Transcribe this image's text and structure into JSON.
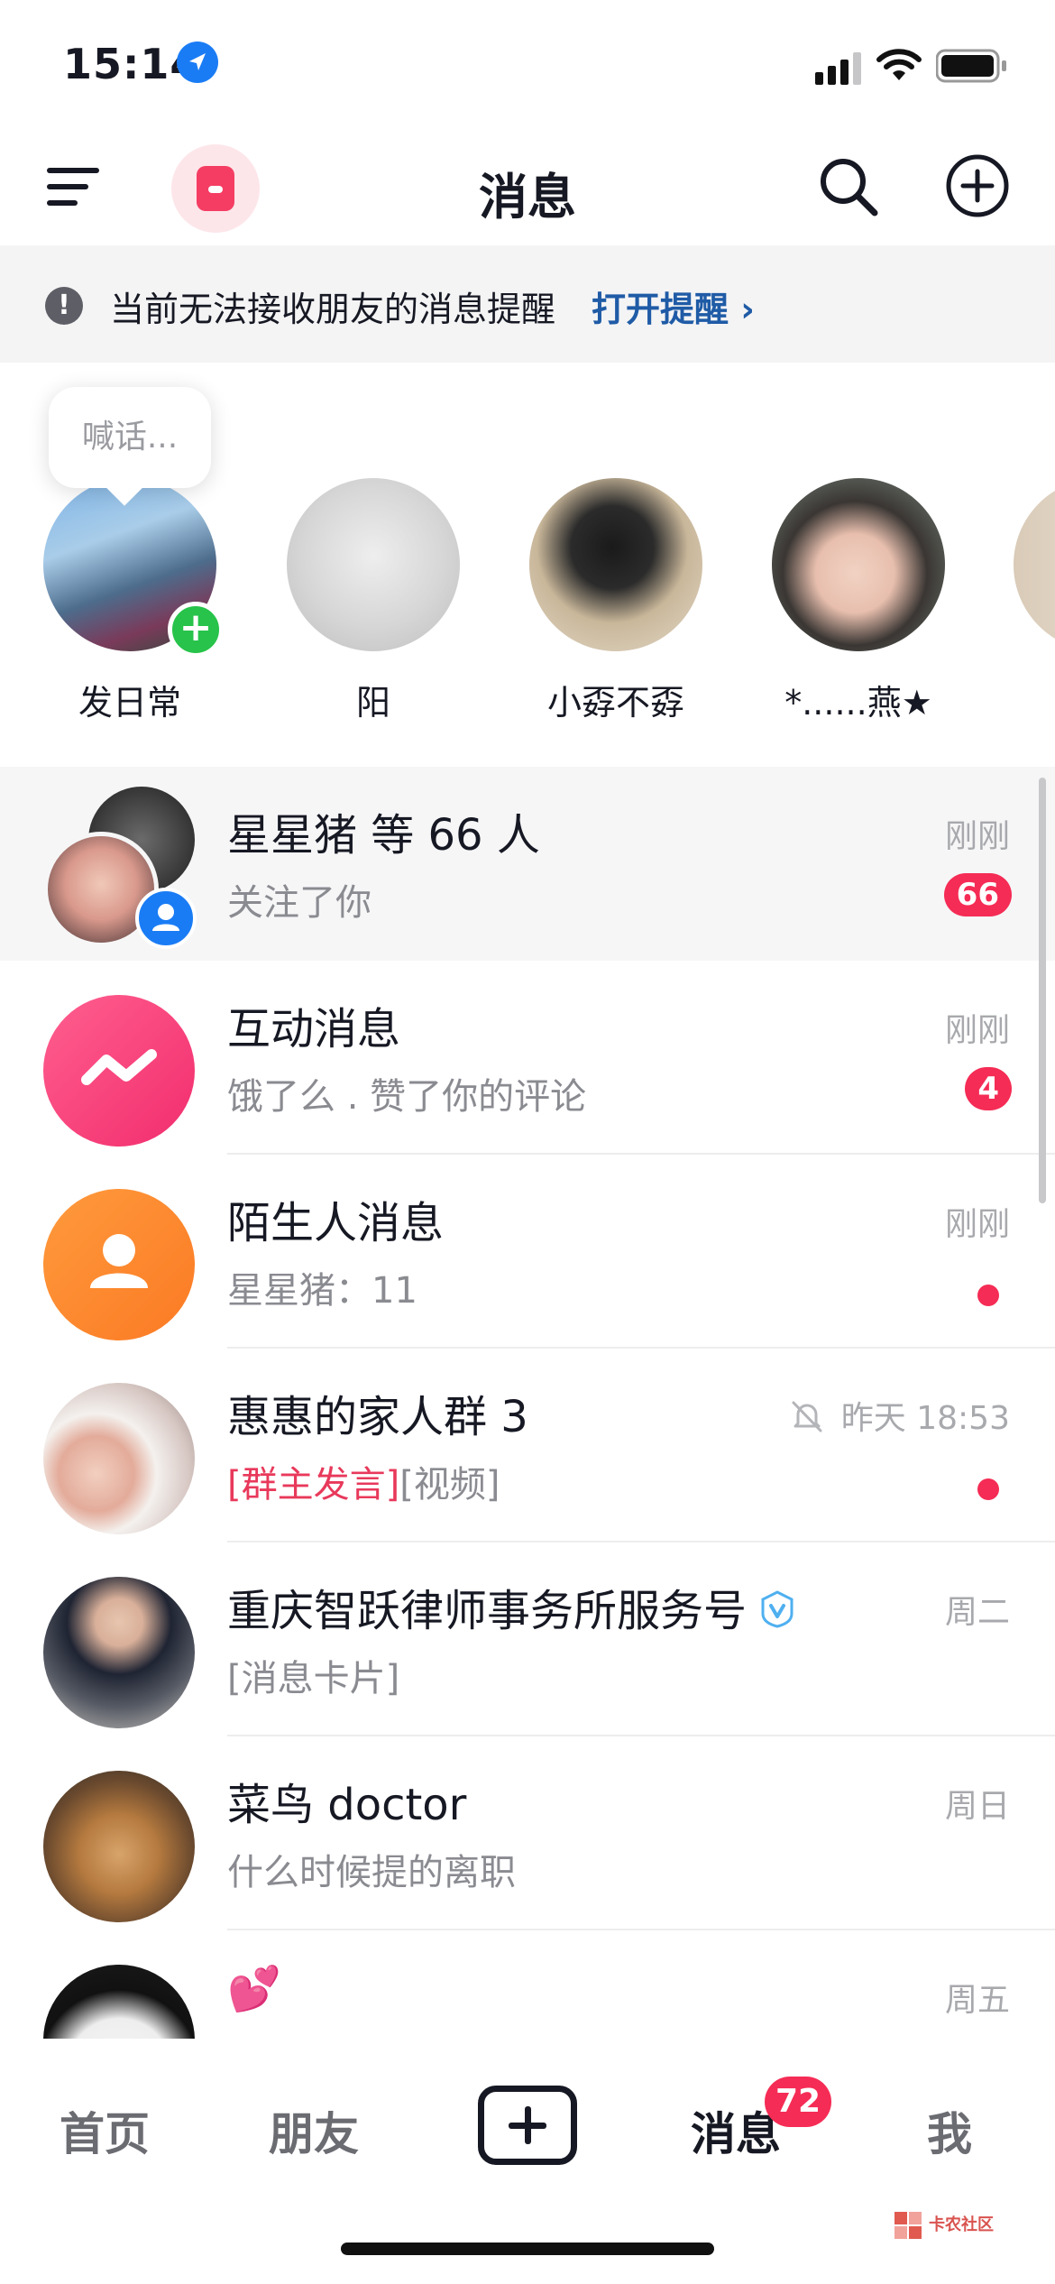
{
  "status_bar": {
    "time": "15:14"
  },
  "header": {
    "title": "消息"
  },
  "notice": {
    "text": "当前无法接收朋友的消息提醒",
    "link": "打开提醒 ›"
  },
  "stories": {
    "bubble": "喊话...",
    "items": [
      {
        "name": "发日常"
      },
      {
        "name": "阳"
      },
      {
        "name": "小孬不孬"
      },
      {
        "name": "*......燕★"
      }
    ]
  },
  "conversations": [
    {
      "title": "星星猪 等 66 人",
      "preview": "关注了你",
      "time": "刚刚",
      "badge": "66"
    },
    {
      "title": "互动消息",
      "preview": "饿了么 . 赞了你的评论",
      "time": "刚刚",
      "badge": "4"
    },
    {
      "title": "陌生人消息",
      "preview": "星星猪：11",
      "time": "刚刚"
    },
    {
      "title": "惠惠的家人群 3",
      "preview_highlight": "[群主发言]",
      "preview": "[视频]",
      "time": "昨天 18:53"
    },
    {
      "title": "重庆智跃律师事务所服务号",
      "preview": "[消息卡片]",
      "time": "周二"
    },
    {
      "title": "菜鸟 doctor",
      "preview": "什么时候提的离职",
      "time": "周日"
    },
    {
      "title": "💕",
      "preview": "",
      "time": "周五"
    }
  ],
  "tab_bar": {
    "home": "首页",
    "friends": "朋友",
    "messages": "消息",
    "messages_badge": "72",
    "me": "我"
  },
  "watermark": {
    "text": "卡农社区"
  },
  "colors": {
    "accent": "#f52c55",
    "link": "#1f5ba6"
  }
}
